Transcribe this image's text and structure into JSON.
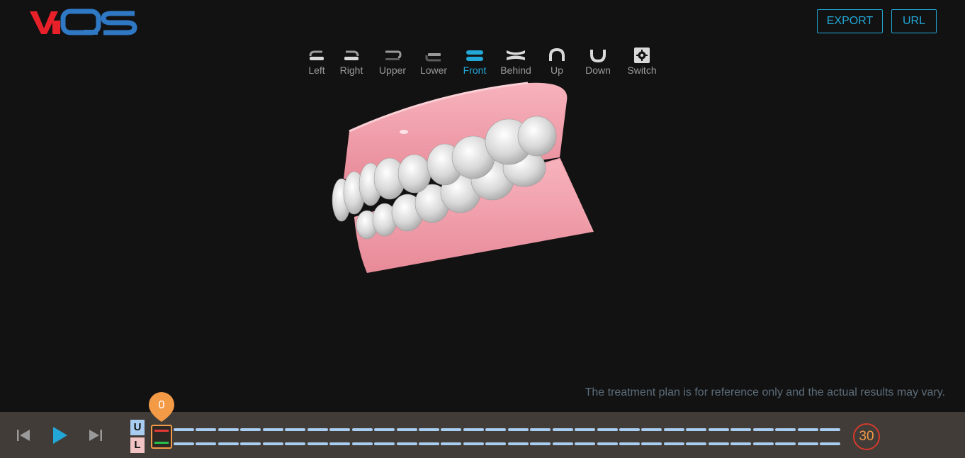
{
  "brand": {
    "logo_text": "VIQS",
    "colors": {
      "red": "#e8202a",
      "blue": "#2f78c4"
    }
  },
  "header": {
    "export_label": "EXPORT",
    "url_label": "URL"
  },
  "views": [
    {
      "label": "Left",
      "icon": "left-view-icon",
      "active": false
    },
    {
      "label": "Right",
      "icon": "right-view-icon",
      "active": false
    },
    {
      "label": "Upper",
      "icon": "upper-view-icon",
      "active": false
    },
    {
      "label": "Lower",
      "icon": "lower-view-icon",
      "active": false
    },
    {
      "label": "Front",
      "icon": "front-view-icon",
      "active": true
    },
    {
      "label": "Behind",
      "icon": "behind-view-icon",
      "active": false
    },
    {
      "label": "Up",
      "icon": "up-view-icon",
      "active": false
    },
    {
      "label": "Down",
      "icon": "down-view-icon",
      "active": false
    },
    {
      "label": "Switch",
      "icon": "gear-icon",
      "active": false
    }
  ],
  "disclaimer": "The treatment plan is for reference only and the actual results may vary.",
  "timeline": {
    "current_stage": "0",
    "total_stages": "30",
    "upper_label": "U",
    "lower_label": "L",
    "accent_color": "#22a7d6",
    "stage_color": "#f39a47"
  }
}
